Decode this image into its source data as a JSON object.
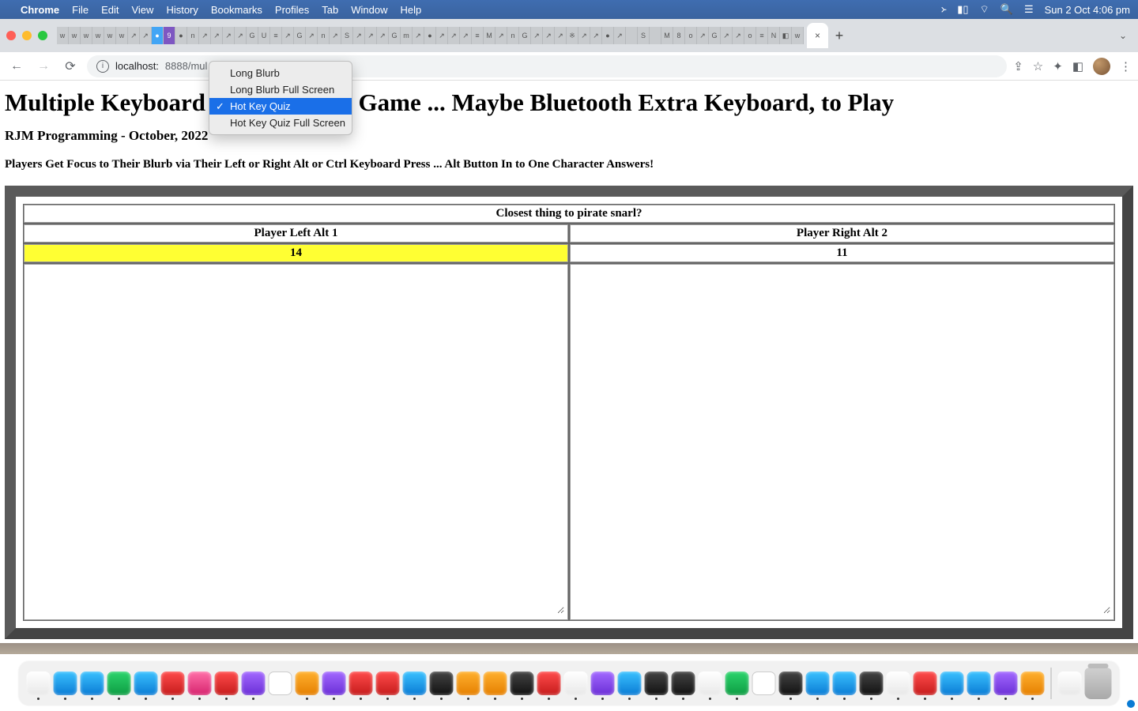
{
  "menubar": {
    "app": "Chrome",
    "items": [
      "File",
      "Edit",
      "View",
      "History",
      "Bookmarks",
      "Profiles",
      "Tab",
      "Window",
      "Help"
    ],
    "clock": "Sun 2 Oct  4:06 pm"
  },
  "browser": {
    "url_display": "localhost:8888/mul",
    "url_host": "localhost:",
    "url_port_path": "8888/mul",
    "active_tab_close": "×",
    "new_tab": "+"
  },
  "dropdown": {
    "items": [
      {
        "label": "Long Blurb",
        "selected": false
      },
      {
        "label": "Long Blurb Full Screen",
        "selected": false
      },
      {
        "label": "Hot Key Quiz",
        "selected": true
      },
      {
        "label": "Hot Key Quiz Full Screen",
        "selected": false
      }
    ]
  },
  "page": {
    "h1_left": "Multiple Keyboard",
    "h1_right": "Game ... Maybe Bluetooth Extra Keyboard, to Play",
    "subtitle": "RJM Programming - October, 2022",
    "note": "Players Get Focus to Their Blurb via Their Left or Right Alt or Ctrl Keyboard Press ... Alt Button In to One Character Answers!",
    "question": "Closest thing to pirate snarl?",
    "player_left_label": "Player Left Alt 1",
    "player_right_label": "Player Right Alt 2",
    "score_left": "14",
    "score_right": "11"
  },
  "dock": {
    "count": 41
  }
}
